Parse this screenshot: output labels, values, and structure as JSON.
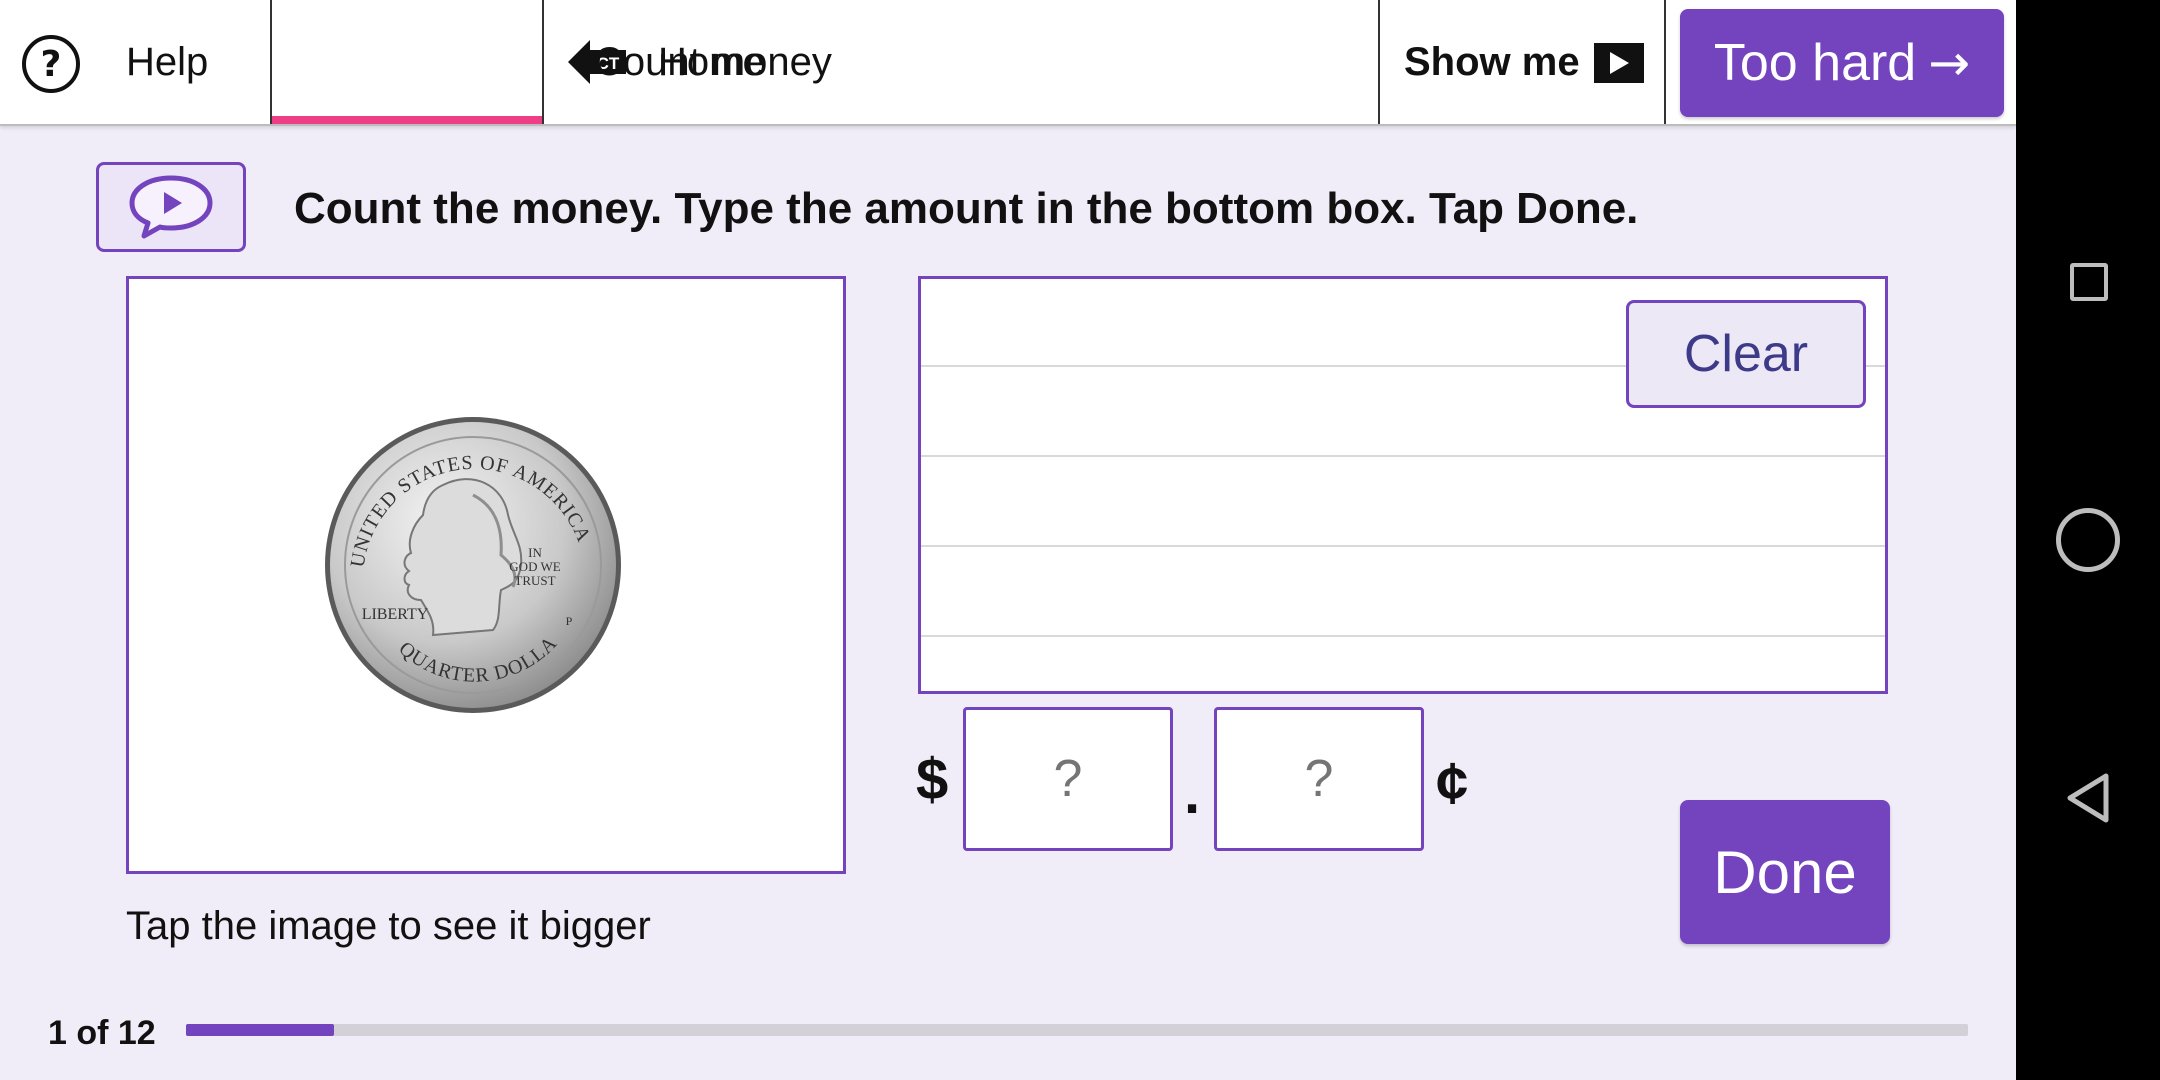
{
  "header": {
    "help_label": "Help",
    "home_label": "Home",
    "home_icon_text": "CT",
    "title": "Count money",
    "show_me_label": "Show me",
    "too_hard_label": "Too hard",
    "too_hard_arrow": "→"
  },
  "instruction": "Count the money. Type the amount in the bottom box. Tap Done.",
  "image_panel": {
    "caption": "Tap the image to see it bigger",
    "coin": {
      "top_text": "UNITED STATES OF AMERICA",
      "motto": [
        "IN",
        "GOD WE",
        "TRUST"
      ],
      "liberty": "LIBERTY",
      "mint_mark": "P",
      "bottom_text": "QUARTER DOLLAR"
    }
  },
  "scratchpad": {
    "clear_label": "Clear"
  },
  "answer": {
    "dollar_symbol": "$",
    "decimal": ".",
    "cent_symbol": "¢",
    "dollars_placeholder": "?",
    "cents_placeholder": "?",
    "dollars_value": "",
    "cents_value": "",
    "done_label": "Done"
  },
  "progress": {
    "label": "1 of 12",
    "current": 1,
    "total": 12
  },
  "colors": {
    "accent": "#7443be",
    "home_underline": "#ee3f86",
    "background": "#f1edf8"
  },
  "icons": {
    "help": "question-circle-icon",
    "home": "back-arrow-ct-icon",
    "show_me": "play-icon",
    "speech": "speech-bubble-play-icon"
  }
}
